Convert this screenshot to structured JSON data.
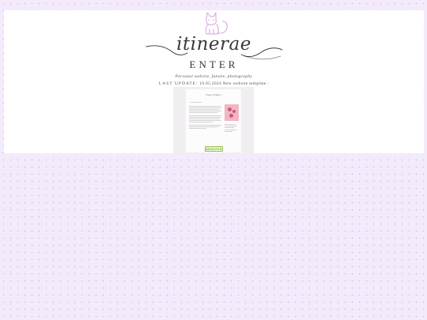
{
  "site": {
    "logo_text": "itinerae",
    "enter_label": "ENTER",
    "tagline": "Personal website, fansite, photography",
    "last_update_label": "LAST UPDATE:",
    "last_update_text": "10.05.2024 New website template :",
    "badge_text": "NEOCITIES"
  },
  "preview": {
    "title": "~ Page of things ~"
  },
  "colors": {
    "page_background": "#f3ebfb",
    "dot": "#d9bfe9",
    "card": "#ffffff",
    "cat_outline": "#d7a0d6",
    "badge_green": "#9bc45a"
  },
  "icons": {
    "mascot": "cat-icon",
    "flourish": "swash-flourish"
  }
}
